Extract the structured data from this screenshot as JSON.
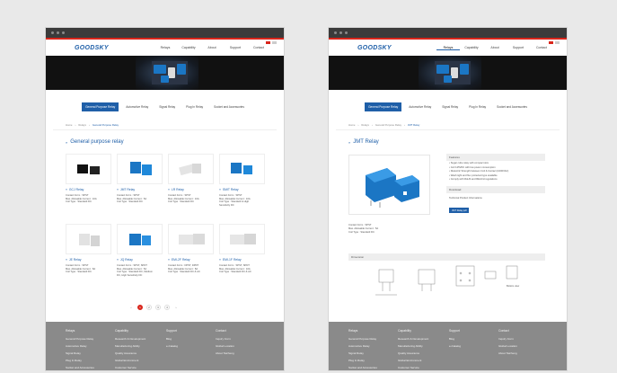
{
  "brand": {
    "logo": "GOODSKY",
    "accent": "#1f5fa8",
    "red": "#d9261c"
  },
  "nav": [
    "Relays",
    "Capability",
    "About",
    "Support",
    "Contact"
  ],
  "tabs": [
    "General Purpose Relay",
    "Automotive Relay",
    "Signal Relay",
    "Plug In Relay",
    "Socket and Accessories"
  ],
  "left": {
    "crumbs": [
      "Home",
      "Relays",
      "General Purpose Relay"
    ],
    "title": "General purpose relay",
    "products": [
      {
        "name": "GCJ Relay",
        "spec": [
          "Contact Form : SPST",
          "Max. Allowable Current : 10A",
          "Coil Type : Standard DC"
        ]
      },
      {
        "name": "JMT Relay",
        "spec": [
          "Contact Form : SPST",
          "Max. Allowable Current : 5A",
          "Coil Type : Standard DC"
        ]
      },
      {
        "name": "LR Relay",
        "spec": [
          "Contact Form : SPST",
          "Max. Allowable Current : 10A",
          "Coil Type : Standard DC"
        ]
      },
      {
        "name": "SMIT Relay",
        "spec": [
          "Contact Form : SPST",
          "Max. Allowable Current : 10A",
          "Coil Type : Standard & High",
          "Sensitivity DC"
        ]
      },
      {
        "name": "JE Relay",
        "spec": [
          "Contact Form : SPST",
          "Max. Allowable Current : 8A",
          "Coil Type : Standard DC"
        ]
      },
      {
        "name": "JQ Relay",
        "spec": [
          "Contact Form : SPST, SPDT",
          "Max. Allowable Current : 5A",
          "Coil Type : Standard DC, Medium",
          "DC, High Sensitivity DC"
        ]
      },
      {
        "name": "EMI-2F Relay",
        "spec": [
          "Contact Form : DPST, DPDT",
          "Max. Allowable Current : 8A",
          "Coil Type : Standard DC & AC"
        ]
      },
      {
        "name": "EMI-1F Relay",
        "spec": [
          "Contact Form : SPST, SPDT",
          "Max. Allowable Current : 10A",
          "Coil Type : Standard DC & AC"
        ]
      }
    ],
    "pager": [
      "‹",
      "1",
      "2",
      "3",
      "4",
      "›"
    ]
  },
  "right": {
    "crumbs": [
      "Home",
      "Relays",
      "General Purpose Relay",
      "JMT Relay"
    ],
    "title": "JMT Relay",
    "spec": [
      "Contact Form : SPST",
      "Max. Allowable Current : 5A",
      "Coil Type : Standard DC"
    ],
    "features_label": "Features",
    "features": [
      "Sugar cube relay with compact size",
      "Coil 125VDC with low power consumption",
      "Dielectric Strength between Coil & Contact (1000VAC)",
      "Wash tight and flux protected type available",
      "Comply with RoHS and REACH regulations"
    ],
    "download_label": "Download",
    "download_item": "Technical Product Informations",
    "download_btn": "JMT Relay.pdf",
    "dimension_label": "Dimension",
    "bottom_view": "Bottom view"
  },
  "footer": {
    "cols": [
      {
        "head": "Relays",
        "items": [
          "General Purpose Relay",
          "Automotive Relay",
          "Signal Relay",
          "Plug In Relay",
          "Socket and Accessories"
        ]
      },
      {
        "head": "Capability",
        "items": [
          "Research & Development",
          "Manufacturing Ability",
          "Quality Assurance",
          "Global Environment",
          "Customer Service"
        ]
      },
      {
        "head": "Support",
        "items": [
          "Blog",
          "e-Catalog"
        ]
      },
      {
        "head": "Contact",
        "items": [
          "Inquiry Form",
          "Global Location",
          "About Taicheng"
        ]
      }
    ]
  }
}
